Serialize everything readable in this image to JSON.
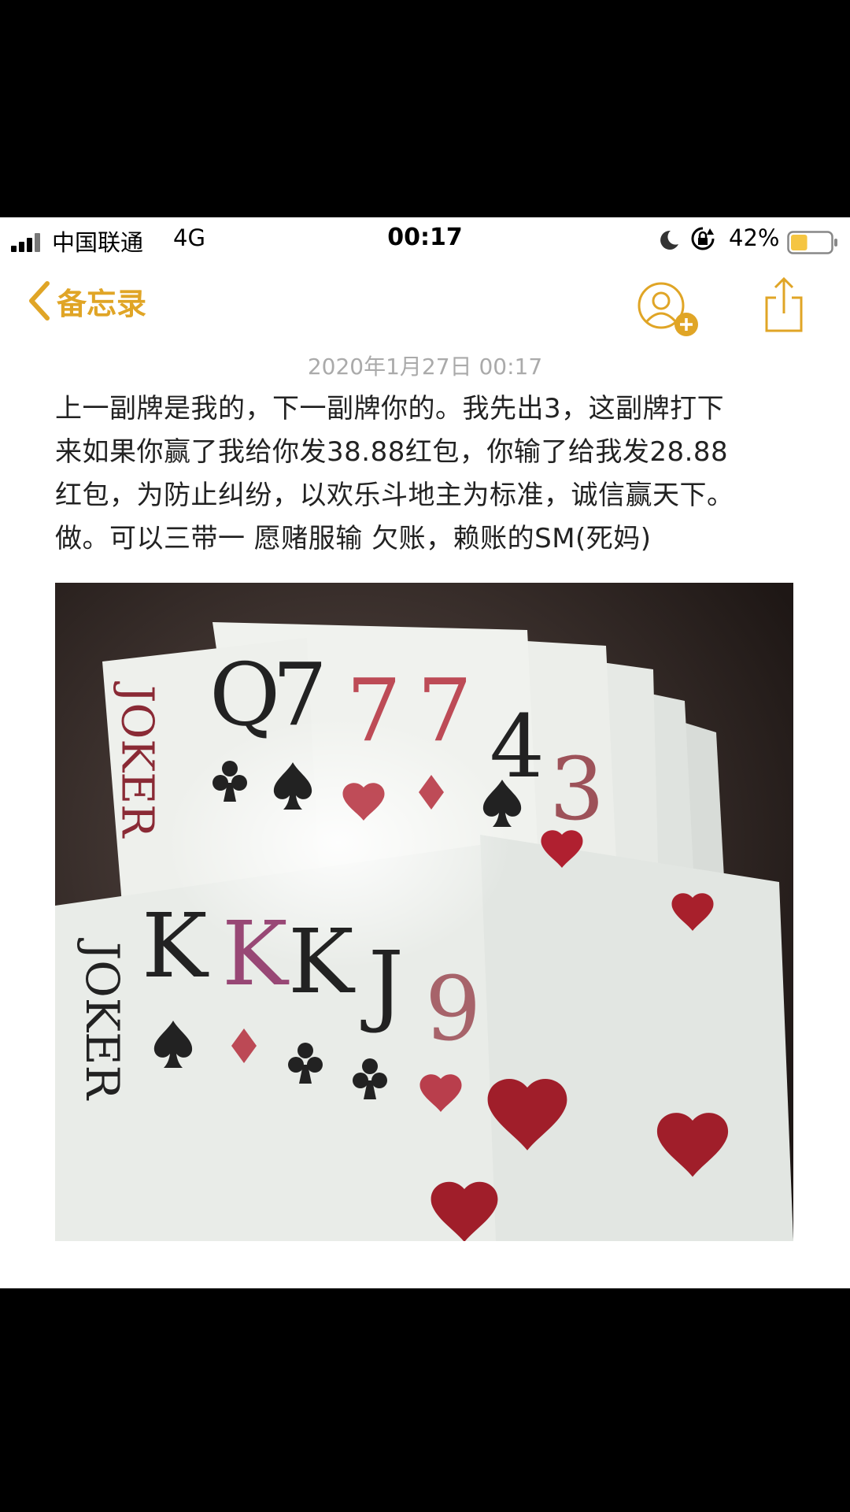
{
  "status_bar": {
    "carrier": "中国联通",
    "network": "4G",
    "time": "00:17",
    "battery_percent": "42%",
    "battery_level": 0.42,
    "icons": [
      "signal-bars-icon",
      "moon-icon",
      "rotation-lock-icon",
      "battery-icon"
    ]
  },
  "nav": {
    "back_label": "备忘录",
    "icons": [
      "chevron-left-icon",
      "add-person-icon",
      "share-icon"
    ]
  },
  "note": {
    "date": "2020年1月27日 00:17",
    "lines": [
      "上一副牌是我的，下一副牌你的。我先出3，这副牌打下",
      "来如果你赢了我给你发38.88红包，你输了给我发28.88",
      "红包，为防止纠纷，以欢乐斗地主为标准，诚信赢天下。",
      "做。可以三带一  愿赌服输 欠账，赖账的SM(死妈)"
    ]
  },
  "photo": {
    "top_hand": [
      "JOKER",
      "Q",
      "7",
      "7",
      "7",
      "4",
      "3"
    ],
    "bottom_hand": [
      "JOKER",
      "K",
      "K",
      "K",
      "J",
      "9"
    ]
  },
  "colors": {
    "accent": "#e0a526",
    "text": "#222222",
    "date": "#aaaaaa",
    "card_red": "#b02030"
  }
}
